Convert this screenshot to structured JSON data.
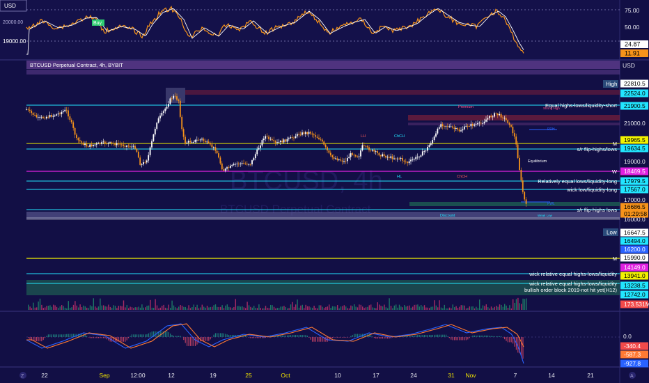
{
  "chart": {
    "title": "BTCUSD Perpetual Contract, 4h, BYBIT",
    "watermark_symbol": "BTCUSD, 4h",
    "watermark_name": "BTCUSD Perpetual Contract",
    "currency": "USD",
    "colors": {
      "background": "#120f45",
      "price_line": "#f7931a",
      "cyan_line": "#22e5ff",
      "yellow_line": "#f2f200",
      "magenta_line": "#e020e0",
      "purple_zone": "#5a3a8a",
      "red_zone": "#7a1f3a",
      "green_zone": "#1f6a55"
    }
  },
  "top_panel": {
    "tl_label": "USD",
    "left_price": "19000.00",
    "left_price_top": "20000.00",
    "right_axis": [
      "75.00",
      "50.00"
    ],
    "value_tags": [
      "24.87",
      "11.91"
    ],
    "buy_label": "Buy"
  },
  "main_axis": {
    "ticks": [
      "21000.0",
      "19000.0",
      "17000.0",
      "16000.0"
    ],
    "high_label": "High",
    "low_label": "Low",
    "tags": [
      {
        "value": "22810.5",
        "bg": "#ffffff",
        "fg": "#000"
      },
      {
        "value": "22524.0",
        "bg": "#22e5ff",
        "fg": "#000"
      },
      {
        "value": "21900.5",
        "bg": "#22e5ff",
        "fg": "#000"
      },
      {
        "value": "19965.5",
        "bg": "#f2f200",
        "fg": "#000"
      },
      {
        "value": "19634.5",
        "bg": "#22e5ff",
        "fg": "#000"
      },
      {
        "value": "18469.5",
        "bg": "#e020e0",
        "fg": "#fff"
      },
      {
        "value": "17979.5",
        "bg": "#22e5ff",
        "fg": "#000"
      },
      {
        "value": "17567.0",
        "bg": "#22e5ff",
        "fg": "#000"
      },
      {
        "value": "16686.5",
        "bg": "#f7931a",
        "fg": "#000"
      },
      {
        "value": "01:29:58",
        "bg": "#f7931a",
        "fg": "#000"
      },
      {
        "value": "16647.5",
        "bg": "#ffffff",
        "fg": "#000"
      },
      {
        "value": "16494.0",
        "bg": "#22e5ff",
        "fg": "#000"
      },
      {
        "value": "16200.0",
        "bg": "#2962ff",
        "fg": "#fff"
      },
      {
        "value": "15990.0",
        "bg": "#ffffff",
        "fg": "#000"
      },
      {
        "value": "14149.0",
        "bg": "#e020e0",
        "fg": "#fff"
      },
      {
        "value": "13941.0",
        "bg": "#f2f200",
        "fg": "#000"
      },
      {
        "value": "13238.5",
        "bg": "#22e5ff",
        "fg": "#000"
      },
      {
        "value": "12742.0",
        "bg": "#22e5ff",
        "fg": "#000"
      },
      {
        "value": "173.531M",
        "bg": "#f24a4a",
        "fg": "#fff"
      }
    ]
  },
  "line_labels": [
    "Equal highs-lows/liquidity-short",
    "M",
    "s/r flip-highs/lows",
    "W",
    "Relatively equal lows/liquidity-long",
    "wick low/liquidity-long",
    "s/r flip-highs lows",
    "M",
    "wick relative equal highs-lows/liquidity",
    "wick relative equal highs-lows/liquidity",
    "bullish order block 2019-not hit yet(H12)"
  ],
  "chart_annotations": [
    "Premium",
    "LH",
    "ChCH",
    "HL",
    "ChCH",
    "Equilibrium",
    "Discount",
    "PDH",
    "PWL",
    "Strong High",
    "Weak Low"
  ],
  "macd_panel": {
    "zero_label": "0.0",
    "tags": [
      {
        "value": "-340.4",
        "bg": "#f24a4a",
        "fg": "#fff"
      },
      {
        "value": "-587.3",
        "bg": "#ff7a33",
        "fg": "#fff"
      },
      {
        "value": "-927.8",
        "bg": "#2962ff",
        "fg": "#fff"
      }
    ]
  },
  "date_axis": {
    "labels": [
      {
        "text": "22",
        "color": "#e8e8f0"
      },
      {
        "text": "Sep",
        "color": "#f2e400"
      },
      {
        "text": "12:00",
        "color": "#e8e8f0"
      },
      {
        "text": "12",
        "color": "#e8e8f0"
      },
      {
        "text": "19",
        "color": "#e8e8f0"
      },
      {
        "text": "25",
        "color": "#f2e400"
      },
      {
        "text": "Oct",
        "color": "#f2e400"
      },
      {
        "text": "10",
        "color": "#e8e8f0"
      },
      {
        "text": "17",
        "color": "#e8e8f0"
      },
      {
        "text": "24",
        "color": "#e8e8f0"
      },
      {
        "text": "31",
        "color": "#f2e400"
      },
      {
        "text": "Nov",
        "color": "#f2e400"
      },
      {
        "text": "7",
        "color": "#e8e8f0"
      },
      {
        "text": "14",
        "color": "#e8e8f0"
      },
      {
        "text": "21",
        "color": "#e8e8f0"
      }
    ]
  }
}
